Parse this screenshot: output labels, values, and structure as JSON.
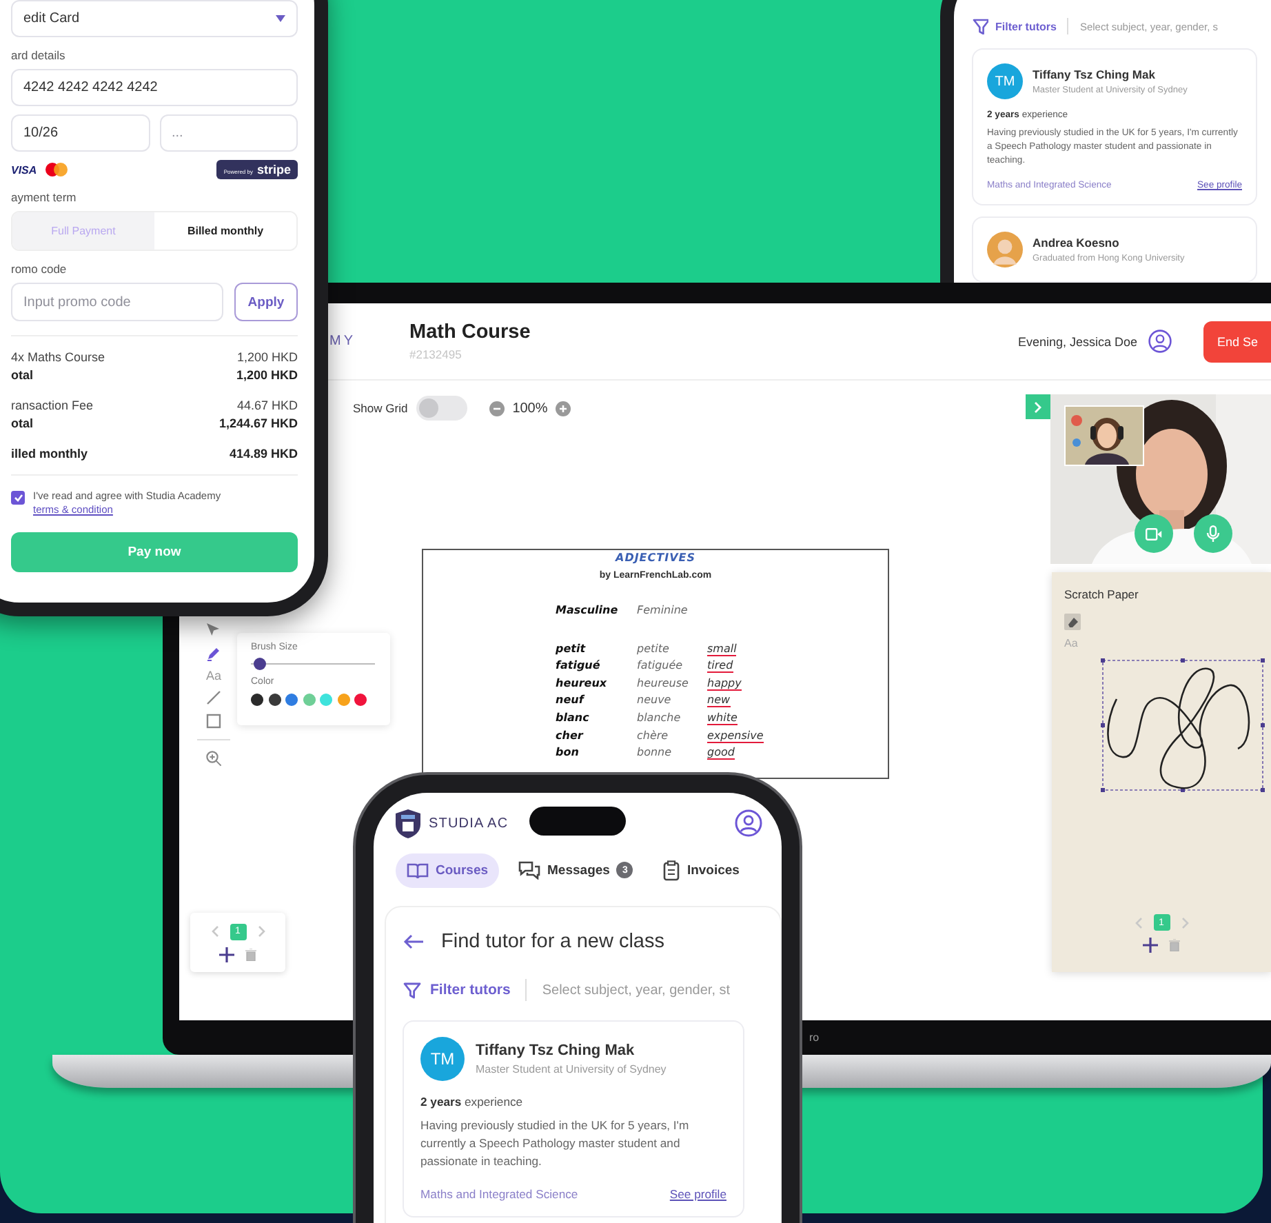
{
  "payment_phone": {
    "payment_method": {
      "value": "edit Card"
    },
    "card_details_label": "ard details",
    "card_number": {
      "value": "4242 4242 4242 4242"
    },
    "expiry": {
      "value": "10/26"
    },
    "cvc": {
      "placeholder": "..."
    },
    "card_brand": "VISA",
    "stripe_badge": {
      "prefix": "Powered by",
      "brand": "stripe"
    },
    "payment_term_label": "ayment term",
    "payment_terms": [
      {
        "label": "Full Payment",
        "selected": false
      },
      {
        "label": "Billed monthly",
        "selected": true
      }
    ],
    "promo_label": "romo code",
    "promo_code": {
      "placeholder": "Input promo code"
    },
    "apply_button": "Apply",
    "summary_groups": [
      {
        "rows": [
          {
            "label": "4x Maths Course",
            "amount": "1,200 HKD",
            "kind": "item"
          },
          {
            "label": "otal",
            "amount": "1,200 HKD",
            "kind": "total"
          }
        ]
      },
      {
        "rows": [
          {
            "label": "ransaction Fee",
            "amount": "44.67 HKD",
            "kind": "item"
          },
          {
            "label": "otal",
            "amount": "1,244.67 HKD",
            "kind": "total"
          }
        ]
      },
      {
        "rows": [
          {
            "label": "illed monthly",
            "amount": "414.89 HKD",
            "kind": "total"
          }
        ]
      }
    ],
    "agreement": {
      "checked": true,
      "text": "I've read and agree with Studia Academy ",
      "link": "terms & condition"
    },
    "pay_button": "Pay now"
  },
  "tutor_tablet": {
    "filter": {
      "label": "Filter tutors",
      "placeholder": "Select subject, year, gender, s"
    },
    "tutors": [
      {
        "avatar": {
          "kind": "initials",
          "text": "TM"
        },
        "name": "Tiffany Tsz Ching Mak",
        "subtitle": "Master Student at University of Sydney",
        "experience": "**2 years** experience",
        "bio": "Having previously studied in the UK for 5 years, I'm currently a Speech Pathology master student and passionate in teaching.",
        "subject": "Maths and Integrated Science",
        "profile_link": "See profile"
      },
      {
        "name": "Andrea Koesno",
        "subtitle": "Graduated from Hong Kong University"
      }
    ]
  },
  "laptop": {
    "brand": "MY",
    "course_title": "Math Course",
    "course_id": "#2132495",
    "greeting": "Evening, Jessica Doe",
    "end_button": "End Se",
    "show_grid": {
      "label": "Show Grid",
      "on": false
    },
    "zoom": {
      "value": "100%"
    },
    "tools": [
      {
        "kind": "pointer",
        "selected": false
      },
      {
        "kind": "pen",
        "selected": true
      },
      {
        "kind": "text",
        "label": "Aa",
        "selected": false
      },
      {
        "kind": "line",
        "selected": false
      },
      {
        "kind": "rectangle",
        "selected": false
      },
      {
        "kind": "zoom",
        "selected": false
      }
    ],
    "brush_panel": {
      "size_label": "Brush Size",
      "level": 0.03,
      "color_label": "Color",
      "colors": [
        {
          "color": "#2b2b2b"
        },
        {
          "color": "#3a3a3a"
        },
        {
          "color": "#2f7de1"
        },
        {
          "color": "#6fcf97"
        },
        {
          "color": "#3ee3dc"
        },
        {
          "color": "#f7a21b"
        },
        {
          "color": "#f0143c"
        }
      ]
    },
    "worksheet": {
      "title": "ADJECTIVES",
      "byline": "by LearnFrenchLab.com",
      "headers": [
        "Masculine",
        "Feminine"
      ],
      "rows": [
        {
          "masculine": "petit",
          "feminine": "petite",
          "english": "small"
        },
        {
          "masculine": "fatigué",
          "feminine": "fatiguée",
          "english": "tired"
        },
        {
          "masculine": "heureux",
          "feminine": "heureuse",
          "english": "happy"
        },
        {
          "masculine": "neuf",
          "feminine": "neuve",
          "english": "new"
        },
        {
          "masculine": "blanc",
          "feminine": "blanche",
          "english": "white"
        },
        {
          "masculine": "cher",
          "feminine": "chère",
          "english": "expensive"
        },
        {
          "masculine": "bon",
          "feminine": "bonne",
          "english": "good"
        }
      ]
    },
    "board_pages": [
      {
        "label": "1",
        "selected": true
      }
    ],
    "scratch_paper": {
      "title": "Scratch Paper",
      "text_tool": "Aa",
      "pages": [
        {
          "label": "1",
          "selected": true
        }
      ]
    },
    "bezel_text": "ro"
  },
  "mobile_phone": {
    "brand": "STUDIA AC",
    "tabs": [
      {
        "kind": "book",
        "label": "Courses",
        "selected": true
      },
      {
        "kind": "chat",
        "label": "Messages",
        "badge": "3",
        "selected": false
      },
      {
        "kind": "clipboard",
        "label": "Invoices",
        "selected": false
      }
    ],
    "page_title": "Find tutor for a new class",
    "filter": {
      "label": "Filter tutors",
      "placeholder": "Select subject, year, gender, st"
    },
    "tutors": [
      {
        "avatar": {
          "kind": "initials",
          "text": "TM"
        },
        "name": "Tiffany Tsz Ching Mak",
        "subtitle": "Master Student at University of Sydney",
        "experience": "**2 years** experience",
        "bio": "Having previously studied in the UK for 5 years, I'm currently a Speech Pathology master student and passionate in teaching.",
        "subject": "Maths and Integrated Science",
        "profile_link": "See profile"
      }
    ]
  }
}
